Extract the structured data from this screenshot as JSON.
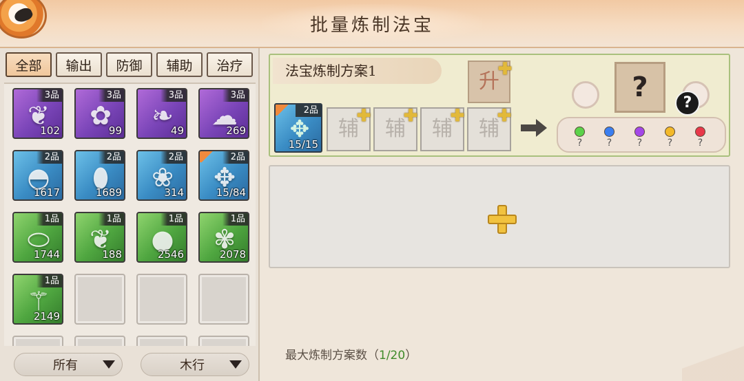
{
  "header": {
    "title": "批量炼制法宝",
    "logo_icon": "bird-emblem-icon"
  },
  "tabs": [
    {
      "label": "全部",
      "active": true
    },
    {
      "label": "输出",
      "active": false
    },
    {
      "label": "防御",
      "active": false
    },
    {
      "label": "辅助",
      "active": false
    },
    {
      "label": "治疗",
      "active": false
    }
  ],
  "inventory": [
    {
      "grade": "3品",
      "count": "102",
      "icon": "peacock-feather-icon",
      "quality": "q3"
    },
    {
      "grade": "3品",
      "count": "99",
      "icon": "flower-branch-icon",
      "quality": "q3"
    },
    {
      "grade": "3品",
      "count": "49",
      "icon": "vine-sprout-icon",
      "quality": "q3"
    },
    {
      "grade": "3品",
      "count": "269",
      "icon": "cloud-icon",
      "quality": "q3"
    },
    {
      "grade": "2品",
      "count": "1617",
      "icon": "powder-dish-icon",
      "quality": "q2"
    },
    {
      "grade": "2品",
      "count": "1689",
      "icon": "amber-stone-icon",
      "quality": "q2"
    },
    {
      "grade": "2品",
      "count": "314",
      "icon": "leaves-icon",
      "quality": "q2"
    },
    {
      "grade": "2品",
      "count": "15/84",
      "icon": "palm-leaf-icon",
      "quality": "q2",
      "flag": true
    },
    {
      "grade": "1品",
      "count": "1744",
      "icon": "jade-stone-icon",
      "quality": "q1"
    },
    {
      "grade": "1品",
      "count": "188",
      "icon": "herb-leaves-icon",
      "quality": "q1"
    },
    {
      "grade": "1品",
      "count": "2546",
      "icon": "peach-icon",
      "quality": "q1"
    },
    {
      "grade": "1品",
      "count": "2078",
      "icon": "blue-flowers-icon",
      "quality": "q1"
    },
    {
      "grade": "1品",
      "count": "2149",
      "icon": "bamboo-icon",
      "quality": "q1"
    }
  ],
  "filters": {
    "left": "所有",
    "right": "木行"
  },
  "recipe": {
    "title": "法宝炼制方案1",
    "upgrade_glyph": "升",
    "main_material": {
      "grade": "2品",
      "count": "15/15",
      "icon": "palm-leaf-icon"
    },
    "aux_slots": [
      "辅",
      "辅",
      "辅",
      "辅"
    ],
    "result_glyph": "?",
    "help_glyph": "?",
    "gems": [
      {
        "color": "#5bd24a",
        "label": "?"
      },
      {
        "color": "#3a7ef0",
        "label": "?"
      },
      {
        "color": "#a347e8",
        "label": "?"
      },
      {
        "color": "#f3b92a",
        "label": "?"
      },
      {
        "color": "#e8384a",
        "label": "?"
      }
    ]
  },
  "footer": {
    "label": "最大炼制方案数（",
    "value": "1/20",
    "suffix": "）"
  }
}
